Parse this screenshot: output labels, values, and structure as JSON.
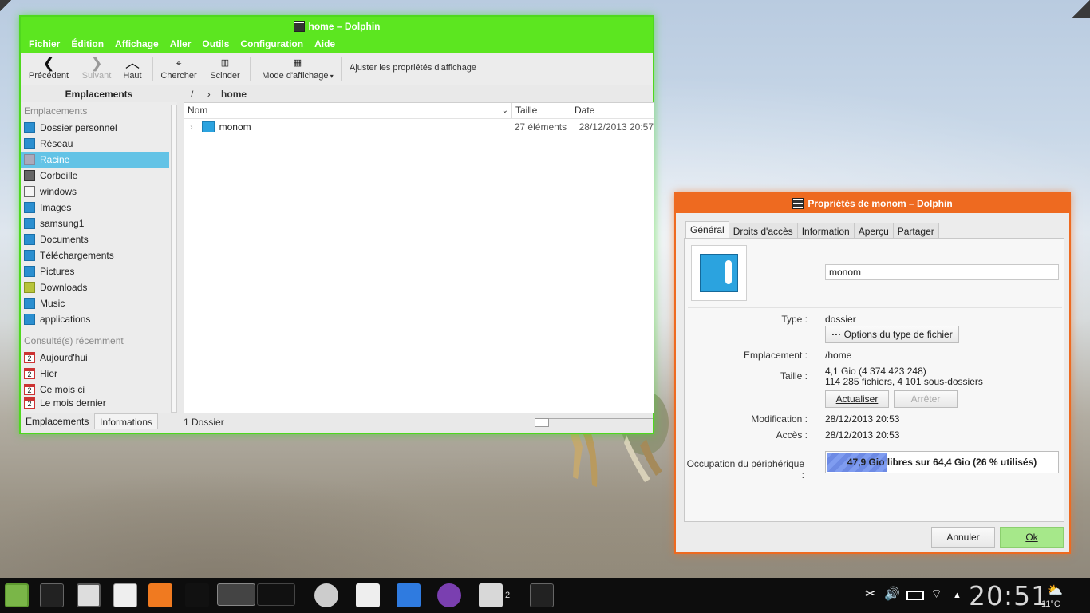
{
  "dolphin": {
    "title": "home – Dolphin",
    "menu": [
      "Fichier",
      "Édition",
      "Affichage",
      "Aller",
      "Outils",
      "Configuration",
      "Aide"
    ],
    "toolbar": {
      "back": "Précédent",
      "forward": "Suivant",
      "up": "Haut",
      "search": "Chercher",
      "split": "Scinder",
      "view_mode": "Mode d'affichage",
      "adjust": "Ajuster les propriétés d'affichage"
    },
    "places_header": "Emplacements",
    "breadcrumb": {
      "root": "/",
      "current": "home"
    },
    "places_group": "Emplacements",
    "places": [
      {
        "label": "Dossier personnel",
        "icon": "home-icon"
      },
      {
        "label": "Réseau",
        "icon": "network-icon"
      },
      {
        "label": "Racine",
        "icon": "root-drive-icon"
      },
      {
        "label": "Corbeille",
        "icon": "trash-icon"
      },
      {
        "label": "windows",
        "icon": "drive-icon"
      },
      {
        "label": "Images",
        "icon": "pictures-folder-icon"
      },
      {
        "label": "samsung1",
        "icon": "folder-icon"
      },
      {
        "label": "Documents",
        "icon": "documents-folder-icon"
      },
      {
        "label": "Téléchargements",
        "icon": "download-folder-icon"
      },
      {
        "label": "Pictures",
        "icon": "pictures-folder-icon"
      },
      {
        "label": "Downloads",
        "icon": "folder-icon"
      },
      {
        "label": "Music",
        "icon": "music-folder-icon"
      },
      {
        "label": "applications",
        "icon": "applications-folder-icon"
      }
    ],
    "recent_group": "Consulté(s) récemment",
    "recent": [
      "Aujourd'hui",
      "Hier",
      "Ce mois ci",
      "Le mois dernier"
    ],
    "calendar_day": "2",
    "bottom_tabs": [
      "Emplacements",
      "Informations"
    ],
    "columns": {
      "name": "Nom",
      "size": "Taille",
      "date": "Date"
    },
    "files": [
      {
        "name": "monom",
        "size": "27 éléments",
        "date": "28/12/2013 20:57"
      }
    ],
    "status": "1 Dossier"
  },
  "props": {
    "title": "Propriétés de monom – Dolphin",
    "tabs": [
      "Général",
      "Droits d'accès",
      "Information",
      "Aperçu",
      "Partager"
    ],
    "name": "monom",
    "type_label": "Type :",
    "type_value": "dossier",
    "file_type_options": "Options du type de fichier",
    "location_label": "Emplacement :",
    "location_value": "/home",
    "size_label": "Taille :",
    "size_value": "4,1 Gio (4 374 423 248)",
    "size_detail": "114 285 fichiers, 4 101 sous-dossiers",
    "refresh": "Actualiser",
    "stop": "Arrêter",
    "modified_label": "Modification :",
    "modified_value": "28/12/2013 20:53",
    "accessed_label": "Accès :",
    "accessed_value": "28/12/2013 20:53",
    "usage_label": "Occupation du périphérique :",
    "usage_text": "47,9 Gio libres sur 64,4 Gio (26 % utilisés)",
    "usage_fraction": 0.26,
    "cancel": "Annuler",
    "ok": "Ok"
  },
  "taskbar": {
    "workspace_badge": "2",
    "clock": "20:51",
    "temperature": "11°C"
  },
  "colors": {
    "dolphin_accent": "#5ce620",
    "dialog_accent": "#ee6a20",
    "selection": "#63c3e6",
    "ok_button": "#a6e88a"
  }
}
